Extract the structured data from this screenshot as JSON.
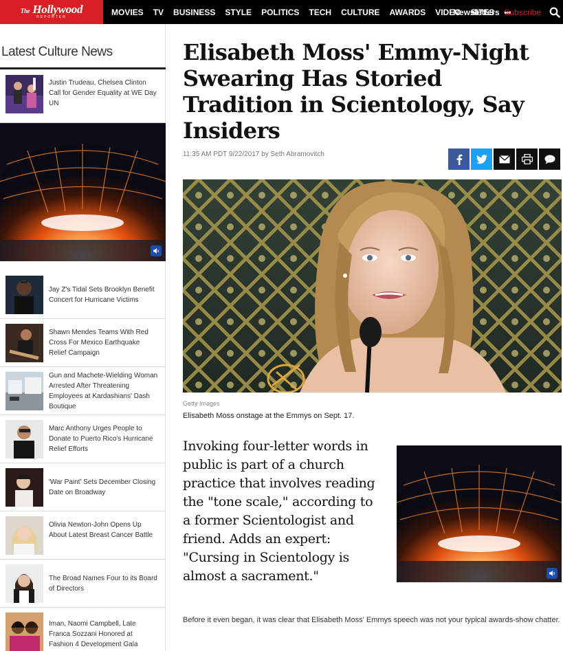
{
  "brand": {
    "name": "Hollywood",
    "prefix": "The",
    "sub": "REPORTER",
    "red": "#d81f26"
  },
  "nav": {
    "items": [
      "MOVIES",
      "TV",
      "BUSINESS",
      "STYLE",
      "POLITICS",
      "TECH",
      "CULTURE",
      "AWARDS",
      "VIDEO",
      "SITES"
    ],
    "more": "•••",
    "newsletters": "Newsletters",
    "subscribe": "Subscribe",
    "search_icon": "search-icon"
  },
  "sidebar": {
    "title": "Latest Culture News",
    "items": [
      {
        "text": "Justin Trudeau, Chelsea Clinton Call for Gender Equality at WE Day UN"
      },
      {
        "text": "Jay Z's Tidal Sets Brooklyn Benefit Concert for Hurricane Victims"
      },
      {
        "text": "Shawn Mendes Teams With Red Cross For Mexico Earthquake Relief Campaign"
      },
      {
        "text": "Gun and Machete-Wielding Woman Arrested After Threatening Employees at Kardashians' Dash Boutique"
      },
      {
        "text": "Marc Anthony Urges People to Donate to Puerto Rico's Hurricane Relief Efforts"
      },
      {
        "text": "'War Paint' Sets December Closing Date on Broadway"
      },
      {
        "text": "Olivia Newton-John Opens Up About Latest Breast Cancer Battle"
      },
      {
        "text": "The Broad Names Four to its Board of Directors"
      },
      {
        "text": "Iman, Naomi Campbell, Late Franca Sozzani Honored at Fashion 4 Development Gala"
      }
    ]
  },
  "article": {
    "headline": "Elisabeth Moss' Emmy-Night Swearing Has Storied Tradition in Scientology, Say Insiders",
    "byline": "11:35 AM PDT 9/22/2017 by Seth Abramovitch",
    "share": [
      "facebook-icon",
      "twitter-icon",
      "email-icon",
      "print-icon",
      "comment-icon"
    ],
    "photo_credit": "Getty Images",
    "caption": "Elisabeth Moss onstage at the Emmys on Sept. 17.",
    "dek": "Invoking four-letter words in public is part of a church practice that involves reading the \"tone scale,\" according to a former Scientologist and friend. Adds an expert: \"Cursing in Scientology is almost a sacrament.\"",
    "body_start": "Before it even began, it was clear that Elisabeth Moss' Emmys speech was not your typical awards-show chatter."
  },
  "colors": {
    "facebook": "#3b5998",
    "twitter": "#1da1f2",
    "dark": "#111111",
    "video_glow": "#ff6a1a"
  }
}
